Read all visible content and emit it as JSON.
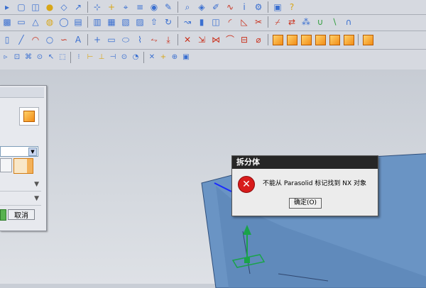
{
  "colors": {
    "toolbar_bg": "#d6d9e0",
    "viewport_bg": "#c9ced6",
    "solid_body": "#6a94c4",
    "solid_edge": "#1a2aff",
    "dialog_title_bg": "#262626",
    "error_red": "#d81b1b",
    "axis_green": "#1aa34a"
  },
  "toolbar": {
    "rows": [
      {
        "icons": [
          "menu-arrow-icon",
          "box-icon",
          "cylinder-icon",
          "sphere-icon",
          "datum-plane-icon",
          "datum-axis-icon",
          "csys-icon",
          "point-icon",
          "wcs-icon",
          "layer-icon",
          "view-icon",
          "edit-object-icon",
          "analysis-icon",
          "render-icon",
          "sketch-icon",
          "curve-icon",
          "info-icon",
          "preferences-icon",
          "application-icon",
          "help-icon"
        ]
      },
      {
        "icons": [
          "block-icon",
          "cylinder-feature-icon",
          "cone-icon",
          "sphere-feature-icon",
          "hole-icon",
          "boss-icon",
          "pocket-icon",
          "pad-icon",
          "slot-icon",
          "groove-icon",
          "extrude-icon",
          "revolve-icon",
          "sweep-icon",
          "thicken-icon",
          "shell-icon",
          "blend-icon",
          "chamfer-icon",
          "trim-body-icon",
          "split-body-icon",
          "mirror-icon",
          "pattern-icon",
          "unite-icon",
          "subtract-icon",
          "intersect-icon"
        ]
      },
      {
        "icons": [
          "sketch-feature-icon",
          "line-icon",
          "arc-icon",
          "circle-icon",
          "spline-icon",
          "text-a-icon",
          "plus-icon",
          "rectangle-icon",
          "ellipse-icon",
          "helix-icon",
          "offset-curve-icon",
          "project-curve-icon",
          "intersect-curve-icon",
          "extract-curve-icon",
          "join-curve-icon",
          "bridge-curve-icon",
          "section-curve-icon",
          "wrap-curve-icon",
          "orange-cube-icon",
          "orange-cube-2-icon",
          "orange-cube-3-icon",
          "orange-cube-4-icon",
          "orange-cube-5-icon",
          "orange-cube-6-icon",
          "orange-cube-7-icon"
        ]
      },
      {
        "icons": [
          "select-icon",
          "snap-icon",
          "filter-icon",
          "scope-icon",
          "pick-icon",
          "rectangle-select-icon",
          "quick-pick-icon",
          "snap-endpoint-icon",
          "snap-midpoint-icon",
          "snap-control-icon",
          "snap-center-icon",
          "snap-quadrant-icon",
          "snap-intersection-icon",
          "snap-point-icon",
          "snap-existing-icon",
          "box-view-icon"
        ]
      }
    ]
  },
  "left_panel": {
    "cancel_label": "取消"
  },
  "dialog": {
    "title": "拆分体",
    "message": "不能从 Parasolid 标记找到 NX 对象",
    "ok_label": "确定(O)"
  }
}
